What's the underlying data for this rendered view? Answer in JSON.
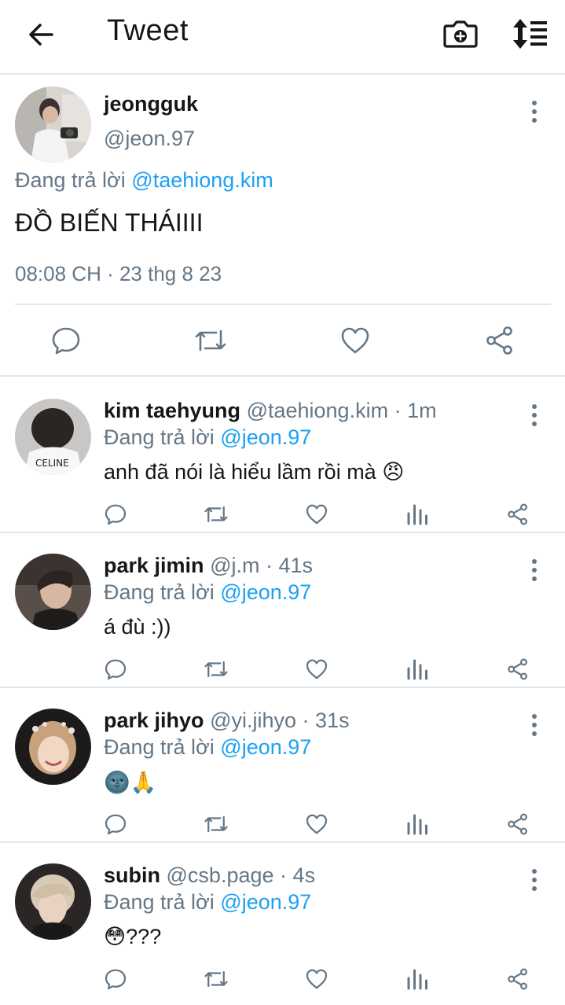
{
  "header": {
    "title": "Tweet",
    "back_icon": "arrow-left-icon",
    "camera_icon": "camera-icon",
    "sort_icon": "sort-icon"
  },
  "main_tweet": {
    "name": "jeongguk",
    "handle": "@jeon.97",
    "reply_prefix": "Đang trả lời",
    "reply_to": "@taehiong.kim",
    "text": "ĐỒ BIẾN THÁIIII",
    "timestamp": "08:08 CH · 23 thg 8 23",
    "actions": [
      "reply-icon",
      "retweet-icon",
      "like-icon",
      "share-icon"
    ]
  },
  "replies": [
    {
      "name": "kim taehyung",
      "handle": "@taehiong.kim",
      "time": "1m",
      "reply_prefix": "Đang trả lời",
      "reply_to": "@jeon.97",
      "text": "anh đã nói là hiểu lầm rồi mà",
      "emoji": "😠"
    },
    {
      "name": "park jimin",
      "handle": "@j.m",
      "time": "41s",
      "reply_prefix": "Đang trả lời",
      "reply_to": "@jeon.97",
      "text": "á đù :))",
      "emoji": ""
    },
    {
      "name": "park jihyo",
      "handle": "@yi.jihyo",
      "time": "31s",
      "reply_prefix": "Đang trả lời",
      "reply_to": "@jeon.97",
      "text": "",
      "emoji": "🌚🙏"
    },
    {
      "name": "subin",
      "handle": "@csb.page",
      "time": "4s",
      "reply_prefix": "Đang trả lời",
      "reply_to": "@jeon.97",
      "text": "???",
      "emoji": "😳"
    }
  ],
  "colors": {
    "link": "#1da1f2",
    "muted": "#657786",
    "text": "#14171a",
    "divider": "#e1e8ed"
  }
}
